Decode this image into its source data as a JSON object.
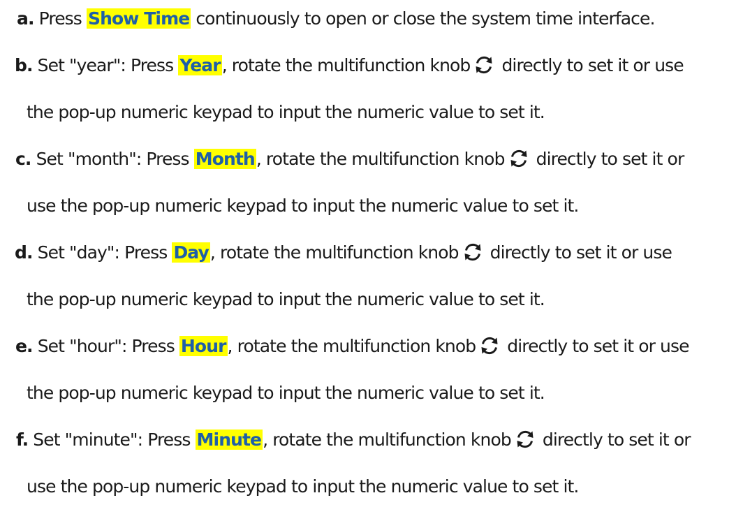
{
  "icon": {
    "name": "rotate-knob-icon",
    "color": "#1a1a1a"
  },
  "highlight": {
    "background": "#ffff00",
    "text": "#1e5fa8"
  },
  "steps": [
    {
      "marker": "a.",
      "pre": " Press ",
      "key": "Show Time",
      "post": " continuously to open or close the system time interface."
    },
    {
      "marker": "b.",
      "pre": " Set \"year\": Press ",
      "key": "Year",
      "post": ", rotate the multifunction knob",
      "after_knob": " directly to set it or use",
      "line2": "the pop-up numeric keypad to input the numeric value to set it."
    },
    {
      "marker": "c.",
      "pre": " Set \"month\": Press ",
      "key": "Month",
      "post": ", rotate the multifunction knob",
      "after_knob": " directly to set it or",
      "line2": "use the pop-up numeric keypad to input the numeric value to set it."
    },
    {
      "marker": "d.",
      "pre": " Set \"day\": Press ",
      "key": "Day",
      "post": ", rotate the multifunction knob",
      "after_knob": " directly to set it or use",
      "line2": "the pop-up numeric keypad to input the numeric value to set it."
    },
    {
      "marker": "e.",
      "pre": " Set \"hour\": Press ",
      "key": "Hour",
      "post": ", rotate the multifunction knob",
      "after_knob": " directly to set it or use",
      "line2": "the pop-up numeric keypad to input the numeric value to set it."
    },
    {
      "marker": "f.",
      "pre": " Set \"minute\": Press ",
      "key": "Minute",
      "post": ", rotate the multifunction knob",
      "after_knob": " directly to set it or",
      "line2": "use the pop-up numeric keypad to input the numeric value to set it."
    }
  ]
}
